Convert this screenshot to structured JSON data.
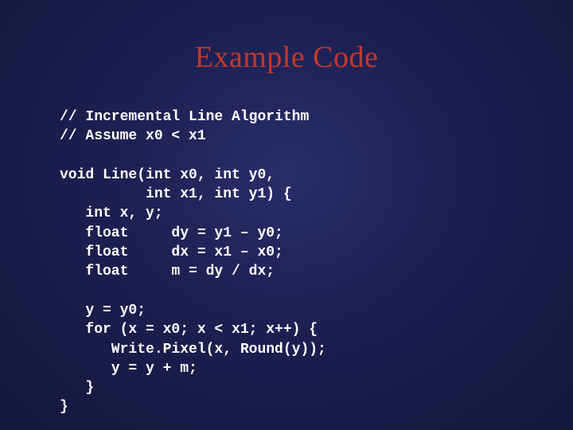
{
  "title": "Example Code",
  "code_lines": {
    "l0": "// Incremental Line Algorithm",
    "l1": "// Assume x0 < x1",
    "l2": "",
    "l3": "void Line(int x0, int y0,",
    "l4": "          int x1, int y1) {",
    "l5": "   int x, y;",
    "l6": "   float     dy = y1 – y0;",
    "l7": "   float     dx = x1 – x0;",
    "l8": "   float     m = dy / dx;",
    "l9": "",
    "l10": "   y = y0;",
    "l11": "   for (x = x0; x < x1; x++) {",
    "l12": "      Write.Pixel(x, Round(y));",
    "l13": "      y = y + m;",
    "l14": "   }",
    "l15": "}"
  }
}
